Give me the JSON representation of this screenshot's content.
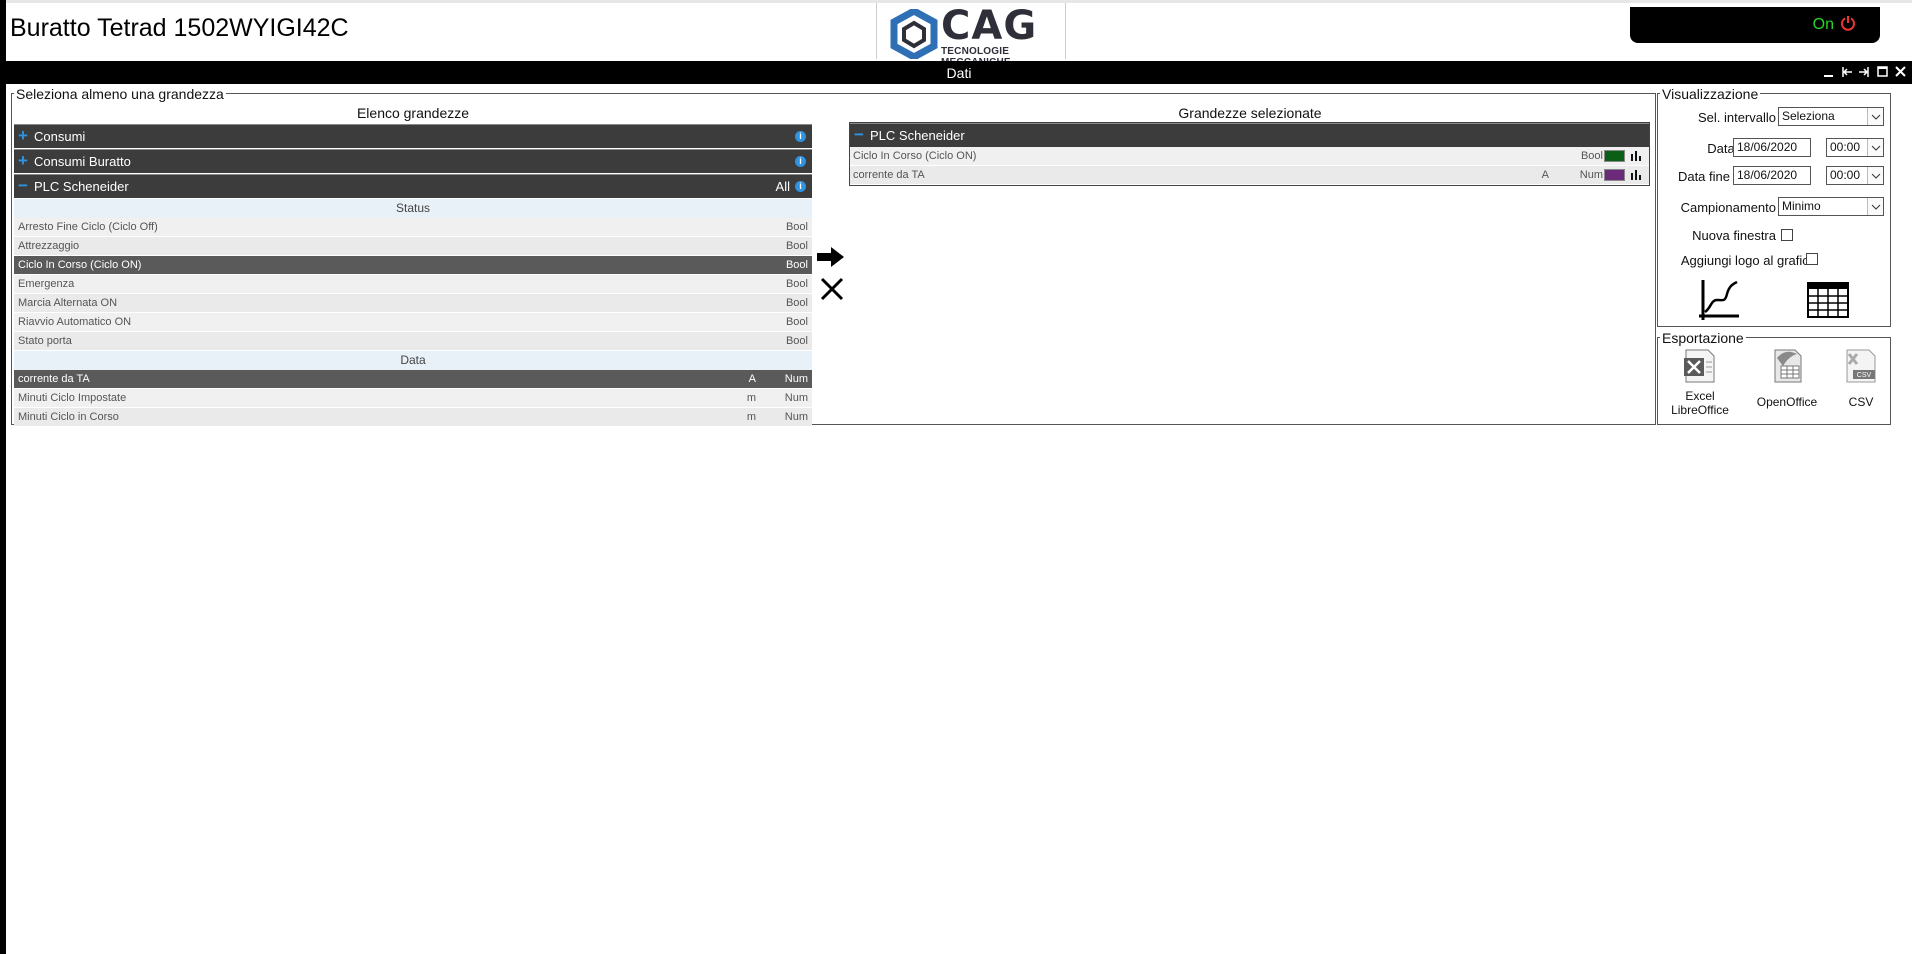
{
  "header": {
    "title": "Buratto Tetrad 1502WYIGI42C",
    "logo_text": "CAG",
    "logo_subtitle": "TECNOLOGIE MECCANICHE",
    "status": "On"
  },
  "panel": {
    "title": "Dati"
  },
  "selection": {
    "legend": "Seleziona almeno una grandezza",
    "left_title": "Elenco grandezze",
    "right_title": "Grandezze selezionate",
    "groups": [
      {
        "name": "Consumi",
        "expanded": false
      },
      {
        "name": "Consumi Buratto",
        "expanded": false
      },
      {
        "name": "PLC Scheneider",
        "expanded": true,
        "all_label": "All"
      }
    ],
    "sections": [
      "Status",
      "Data"
    ],
    "status_rows": [
      {
        "name": "Arresto Fine Ciclo (Ciclo Off)",
        "unit": "",
        "type": "Bool"
      },
      {
        "name": "Attrezzaggio",
        "unit": "",
        "type": "Bool"
      },
      {
        "name": "Ciclo In Corso (Ciclo ON)",
        "unit": "",
        "type": "Bool",
        "selected": true
      },
      {
        "name": "Emergenza",
        "unit": "",
        "type": "Bool"
      },
      {
        "name": "Marcia Alternata ON",
        "unit": "",
        "type": "Bool"
      },
      {
        "name": "Riavvio Automatico ON",
        "unit": "",
        "type": "Bool"
      },
      {
        "name": "Stato porta",
        "unit": "",
        "type": "Bool"
      }
    ],
    "data_rows": [
      {
        "name": "corrente da TA",
        "unit": "A",
        "type": "Num",
        "selected": true
      },
      {
        "name": "Minuti Ciclo Impostate",
        "unit": "m",
        "type": "Num"
      },
      {
        "name": "Minuti Ciclo in Corso",
        "unit": "m",
        "type": "Num"
      }
    ],
    "selected_group": "PLC Scheneider",
    "selected_rows": [
      {
        "name": "Ciclo In Corso (Ciclo ON)",
        "unit": "",
        "type": "Bool",
        "color": "#0b5e16"
      },
      {
        "name": "corrente da TA",
        "unit": "A",
        "type": "Num",
        "color": "#6b2a7a"
      }
    ]
  },
  "visualizzazione": {
    "legend": "Visualizzazione",
    "interval_label": "Sel. intervallo",
    "interval_value": "Seleziona",
    "start_label": "Data inizio",
    "start_date": "18/06/2020",
    "start_time": "00:00",
    "end_label": "Data fine",
    "end_date": "18/06/2020",
    "end_time": "00:00",
    "sampling_label": "Campionamento",
    "sampling_value": "Minimo",
    "new_window_label": "Nuova finestra",
    "logo_label": "Aggiungi logo al grafico"
  },
  "esportazione": {
    "legend": "Esportazione",
    "excel_line1": "Excel",
    "excel_line2": "LibreOffice",
    "openoffice": "OpenOffice",
    "csv": "CSV",
    "csv_icon_text": "CSV"
  }
}
